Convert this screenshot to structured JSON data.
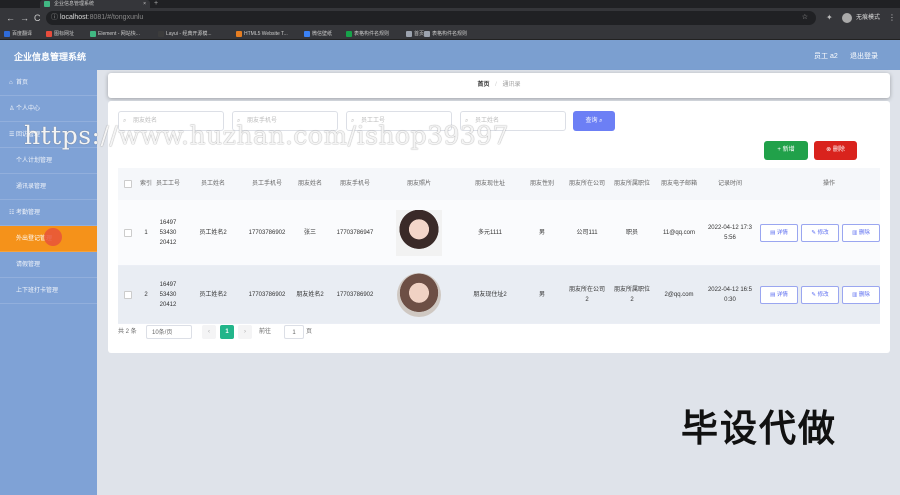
{
  "browser": {
    "tab_title": "企业信息管理系统",
    "tab_close": "×",
    "new_tab": "+",
    "url_host": "localhost",
    "url_path": ":8081/#/tongxunlu",
    "lock": "ⓘ",
    "star": "☆",
    "ext": "✦",
    "profile": "无痕模式",
    "more": "⋮",
    "back": "←",
    "forward": "→",
    "reload": "C",
    "bookmarks": [
      "百度翻译",
      "图标网址",
      "Element - 网站快...",
      "Layui - 经典开源模...",
      "HTML5 Website T...",
      "微信壁纸",
      "表格构件名规则",
      "首页",
      "表格构件名规则"
    ],
    "bookmark_colors": [
      "#2f6bd8",
      "#e74c3c",
      "#41b883",
      "#3c3c3c",
      "#e67e22",
      "#3b82f6",
      "#16a34a",
      "#9ca3af",
      "#9ca3af"
    ]
  },
  "header": {
    "title": "企业信息管理系统",
    "user": "员工 a2",
    "logout": "退出登录"
  },
  "sidebar": {
    "items": [
      {
        "label": "首页",
        "icon": "⌂"
      },
      {
        "label": "个人中心",
        "icon": "♙"
      },
      {
        "label": "回访管理",
        "icon": "☰"
      },
      {
        "label": "个人计划管理",
        "icon": ""
      },
      {
        "label": "通讯录管理",
        "icon": ""
      },
      {
        "label": "考勤管理",
        "icon": "☷"
      },
      {
        "label": "外出登记管理",
        "icon": ""
      },
      {
        "label": "请假管理",
        "icon": ""
      },
      {
        "label": "上下班打卡管理",
        "icon": ""
      }
    ],
    "active_color": "#f5921a"
  },
  "breadcrumb": {
    "home": "首页",
    "sep": "/",
    "current": "通讯录"
  },
  "search": {
    "fields": [
      "朋友姓名",
      "朋友手机号",
      "员工工号",
      "员工姓名"
    ],
    "button": "查询"
  },
  "actions": {
    "add": "新增",
    "delete": "删除",
    "add_icon": "+",
    "del_icon": "⊗"
  },
  "table": {
    "headers": [
      "索引",
      "员工工号",
      "员工姓名",
      "员工手机号",
      "朋友姓名",
      "朋友手机号",
      "朋友照片",
      "朋友现住址",
      "朋友性别",
      "朋友所在公司",
      "朋友所属职位",
      "朋友电子邮箱",
      "记录时间",
      "操作"
    ],
    "rows": [
      {
        "index": "1",
        "emp_no": "1649753430 20412",
        "emp_name": "员工姓名2",
        "emp_phone": "17703786902",
        "friend_name": "张三",
        "friend_phone": "17703786947",
        "address": "多元1111",
        "gender": "男",
        "company": "公司111",
        "position": "职员",
        "email": "11@qq.com",
        "time": "2022-04-12 17:35:56"
      },
      {
        "index": "2",
        "emp_no": "1649753430 20412",
        "emp_name": "员工姓名2",
        "emp_phone": "17703786902",
        "friend_name": "朋友姓名2",
        "friend_phone": "17703786902",
        "address": "朋友现住址2",
        "gender": "男",
        "company": "朋友所在公司2",
        "position": "朋友所属职位2",
        "email": "2@qq.com",
        "time": "2022-04-12 16:50:30"
      }
    ],
    "ops": [
      "详情",
      "修改",
      "删除"
    ]
  },
  "pager": {
    "total": "共 2 条",
    "size": "10条/页",
    "prev": "‹",
    "current": "1",
    "next": "›",
    "goto": "前往",
    "jump": "1",
    "unit": "页"
  },
  "watermark": {
    "url": "https://www.huzhan.com/ishop39397",
    "cn": "毕设代做"
  }
}
